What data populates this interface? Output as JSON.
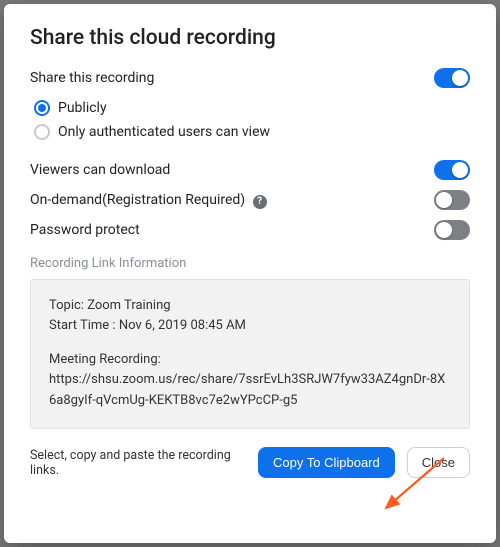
{
  "title": "Share this cloud recording",
  "share_row": {
    "label": "Share this recording",
    "on": true
  },
  "radios": {
    "publicly": "Publicly",
    "authenticated": "Only authenticated users can view",
    "selected": "publicly"
  },
  "download_row": {
    "label": "Viewers can download",
    "on": true
  },
  "ondemand_row": {
    "label": "On-demand(Registration Required)",
    "on": false
  },
  "password_row": {
    "label": "Password protect",
    "on": false
  },
  "link_section_label": "Recording Link Information",
  "info": {
    "topic_label": "Topic:",
    "topic_value": "Zoom Training",
    "start_label": "Start Time :",
    "start_value": "Nov 6, 2019 08:45 AM",
    "recording_label": "Meeting Recording:",
    "recording_url": "https://shsu.zoom.us/rec/share/7ssrEvLh3SRJW7fyw33AZ4gnDr-8X6a8gyIf-qVcmUg-KEKTB8vc7e2wYPcCP-g5"
  },
  "footer_hint": "Select, copy and paste the recording links.",
  "buttons": {
    "copy": "Copy To Clipboard",
    "close": "Close"
  },
  "colors": {
    "accent": "#0E71EB",
    "toggle_off": "#7d8085",
    "arrow": "#FF5A1F"
  }
}
